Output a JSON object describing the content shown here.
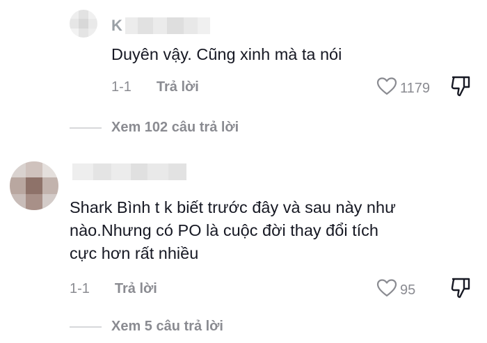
{
  "comments": [
    {
      "author_initial": "K",
      "text_lines": [
        "Duyên vậy. Cũng xinh mà ta nói"
      ],
      "date": "1-1",
      "reply_label": "Trả lời",
      "like_count": "1179",
      "view_replies": "Xem 102 câu trả lời"
    },
    {
      "author_initial": "",
      "text_lines": [
        "Shark Bình t k biết trước đây và sau này như",
        "nào.Nhưng có PO là cuộc đời thay đổi tích",
        "cực hơn rất nhiều"
      ],
      "date": "1-1",
      "reply_label": "Trả lời",
      "like_count": "95",
      "view_replies": "Xem 5 câu trả lời"
    }
  ],
  "icons": {
    "like": "heart-outline-icon",
    "dislike": "thumbs-down-outline-icon"
  },
  "colors": {
    "text": "#161823",
    "secondary": "#8a8b91",
    "divider": "#d7d8da"
  }
}
